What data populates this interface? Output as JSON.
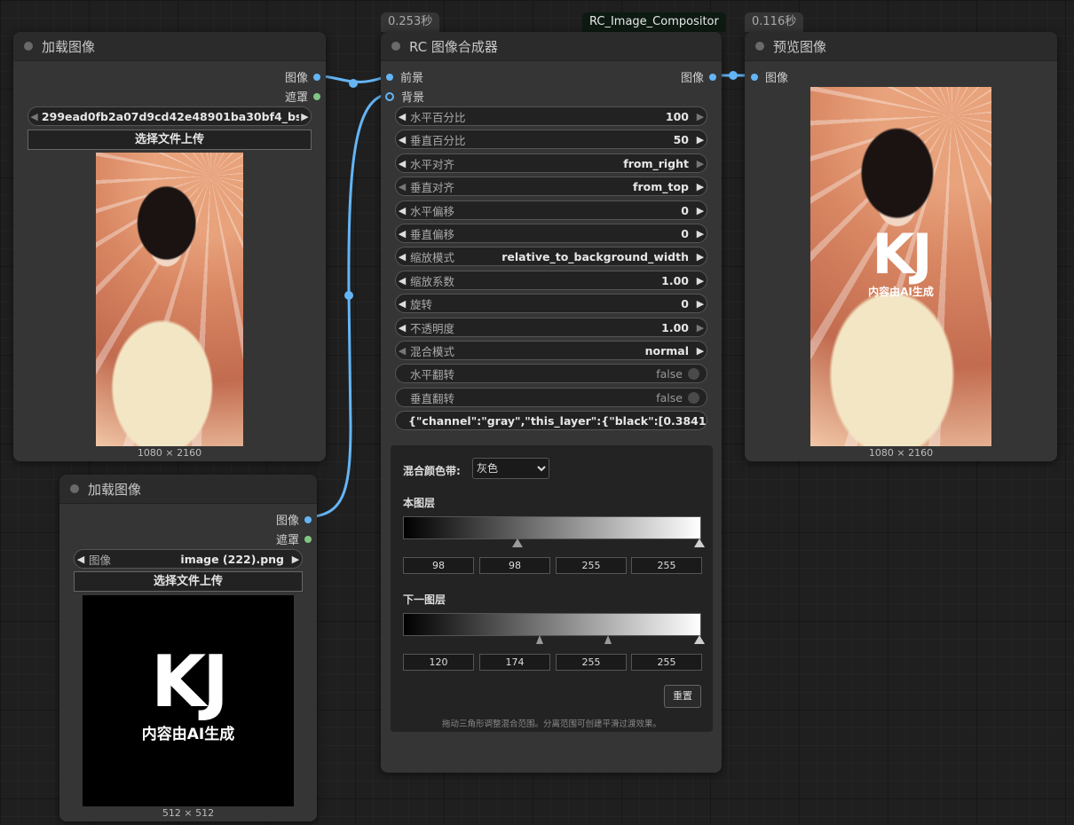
{
  "badges": {
    "compositor_time": "0.253秒",
    "compositor_class": "RC_Image_Compositor",
    "preview_time": "0.116秒"
  },
  "load1": {
    "title": "加载图像",
    "out_image": "图像",
    "out_mask": "遮罩",
    "filename": "299ead0fb2a07d9cd42e48901ba30bf4_bs...",
    "upload": "选择文件上传",
    "size": "1080 × 2160"
  },
  "load2": {
    "title": "加载图像",
    "out_image": "图像",
    "out_mask": "遮罩",
    "combo_label": "图像",
    "filename": "image (222).png",
    "upload": "选择文件上传",
    "size": "512 × 512",
    "logo_text": "KJ",
    "logo_sub": "内容由AI生成"
  },
  "compositor": {
    "title": "RC 图像合成器",
    "in_fg": "前景",
    "in_bg": "背景",
    "out_image": "图像",
    "widgets": [
      {
        "label": "水平百分比",
        "value": "100"
      },
      {
        "label": "垂直百分比",
        "value": "50"
      },
      {
        "label": "水平对齐",
        "value": "from_right"
      },
      {
        "label": "垂直对齐",
        "value": "from_top"
      },
      {
        "label": "水平偏移",
        "value": "0"
      },
      {
        "label": "垂直偏移",
        "value": "0"
      },
      {
        "label": "缩放模式",
        "value": "relative_to_background_width"
      },
      {
        "label": "缩放系数",
        "value": "1.00"
      },
      {
        "label": "旋转",
        "value": "0"
      },
      {
        "label": "不透明度",
        "value": "1.00"
      },
      {
        "label": "混合模式",
        "value": "normal"
      },
      {
        "label": "水平翻转",
        "value": "false"
      },
      {
        "label": "垂直翻转",
        "value": "false"
      }
    ],
    "json_text": "{\"channel\":\"gray\",\"this_layer\":{\"black\":[0.3841353943...",
    "blend": {
      "channel_label": "混合颜色带:",
      "channel_value": "灰色",
      "this_layer_label": "本图层",
      "this_layer_values": [
        "98",
        "98",
        "255",
        "255"
      ],
      "under_layer_label": "下一图层",
      "under_layer_values": [
        "120",
        "174",
        "255",
        "255"
      ],
      "reset": "重置",
      "hint": "拖动三角形调整混合范围。分离范围可创建平滑过渡效果。"
    }
  },
  "preview": {
    "title": "预览图像",
    "in_image": "图像",
    "size": "1080 × 2160",
    "logo_text": "KJ",
    "logo_sub": "内容由AI生成"
  },
  "colors": {
    "link": "#64b5f6",
    "mask_slot": "#81c784"
  }
}
